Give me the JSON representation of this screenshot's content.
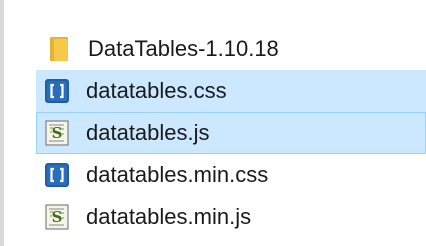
{
  "files": [
    {
      "name": "DataTables-1.10.18",
      "icon": "folder-icon",
      "selected": false
    },
    {
      "name": "datatables.css",
      "icon": "css-file-icon",
      "selected": true
    },
    {
      "name": "datatables.js",
      "icon": "js-file-icon",
      "selected": true
    },
    {
      "name": "datatables.min.css",
      "icon": "css-file-icon",
      "selected": false
    },
    {
      "name": "datatables.min.js",
      "icon": "js-file-icon",
      "selected": false
    }
  ],
  "colors": {
    "selection": "#cce8ff",
    "selection_border": "#99d1ff",
    "folder": "#f7c948",
    "css_icon": "#1e5fa8",
    "js_icon": "#5a7d2a"
  }
}
